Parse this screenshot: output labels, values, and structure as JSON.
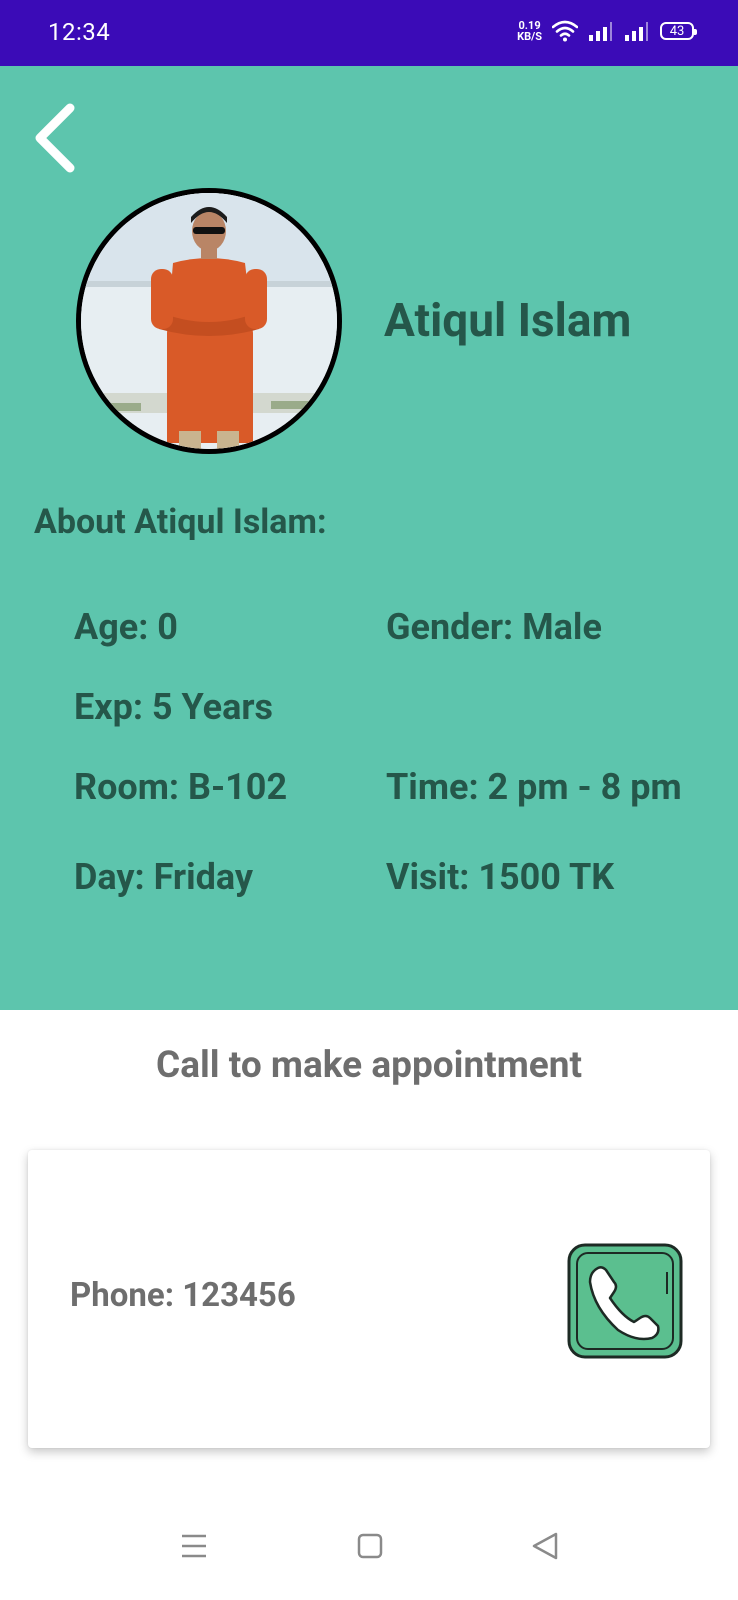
{
  "status_bar": {
    "time": "12:34",
    "net_speed_value": "0.19",
    "net_speed_unit": "KB/S",
    "battery": "43"
  },
  "profile": {
    "name": "Atiqul Islam",
    "about_heading": "About Atiqul Islam:",
    "age": "Age: 0",
    "gender": "Gender: Male",
    "experience": "Exp: 5 Years",
    "room": "Room: B-102",
    "time": "Time: 2 pm - 8 pm",
    "day": "Day: Friday",
    "visit": "Visit: 1500 TK"
  },
  "appointment": {
    "title": "Call to make appointment",
    "phone": "Phone: 123456"
  },
  "colors": {
    "status_bar": "#3b0bb7",
    "panel_bg": "#5dc5ad",
    "panel_text": "#25574a",
    "call_icon_bg": "#5bbf8f"
  },
  "icons": {
    "back": "chevron-left-icon",
    "call": "phone-icon",
    "nav_menu": "menu-icon",
    "nav_home": "square-home-icon",
    "nav_back": "triangle-back-icon"
  }
}
